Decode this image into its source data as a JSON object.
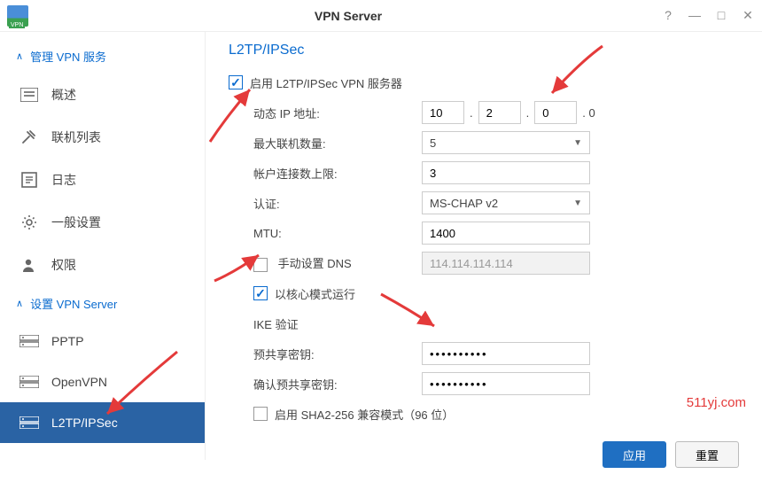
{
  "window": {
    "title": "VPN Server"
  },
  "sidebar": {
    "section1": {
      "label": "管理 VPN 服务"
    },
    "items1": [
      {
        "label": "概述"
      },
      {
        "label": "联机列表"
      },
      {
        "label": "日志"
      },
      {
        "label": "一般设置"
      },
      {
        "label": "权限"
      }
    ],
    "section2": {
      "label": "设置 VPN Server"
    },
    "items2": [
      {
        "label": "PPTP"
      },
      {
        "label": "OpenVPN"
      },
      {
        "label": "L2TP/IPSec"
      }
    ]
  },
  "page": {
    "title": "L2TP/IPSec",
    "enable_label": "启用 L2TP/IPSec VPN 服务器",
    "dynamic_ip_label": "动态 IP 地址:",
    "ip": {
      "a": "10",
      "b": "2",
      "c": "0",
      "suffix": ". 0"
    },
    "max_conn_label": "最大联机数量:",
    "max_conn_value": "5",
    "acct_limit_label": "帐户连接数上限:",
    "acct_limit_value": "3",
    "auth_label": "认证:",
    "auth_value": "MS-CHAP v2",
    "mtu_label": "MTU:",
    "mtu_value": "1400",
    "manual_dns_label": "手动设置 DNS",
    "dns_value": "114.114.114.114",
    "kernel_mode_label": "以核心模式运行",
    "ike_label": "IKE 验证",
    "psk_label": "预共享密钥:",
    "psk_value": "••••••••••",
    "psk_confirm_label": "确认预共享密钥:",
    "psk_confirm_value": "••••••••••",
    "sha2_label": "启用 SHA2-256 兼容模式（96 位）",
    "apply_btn": "应用",
    "reset_btn": "重置"
  },
  "watermark": "511yj.com"
}
